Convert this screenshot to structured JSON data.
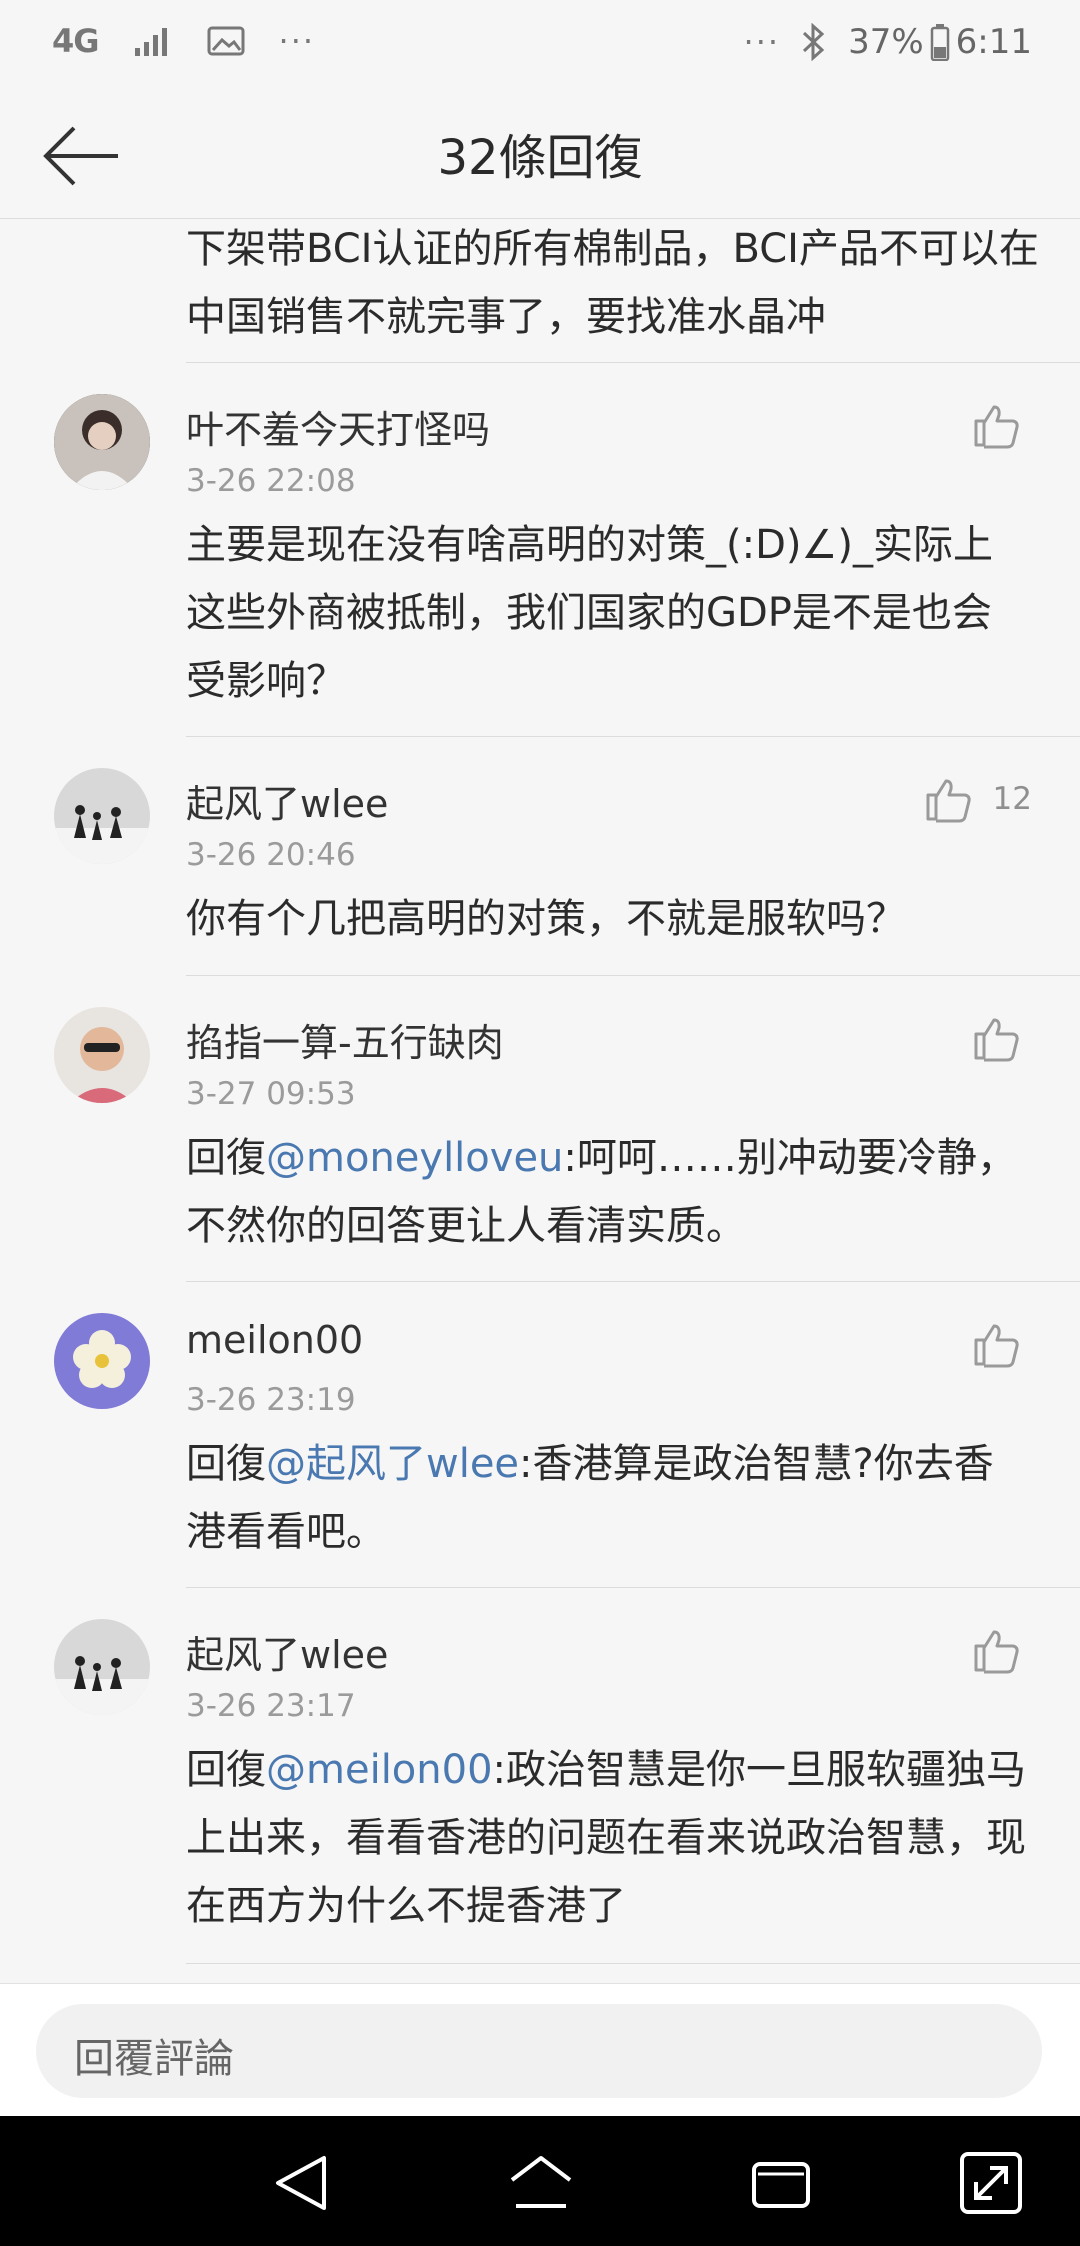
{
  "status_bar": {
    "network": "4G",
    "left_dots": "···",
    "right_dots": "···",
    "battery": "37%",
    "time": "6:11"
  },
  "header": {
    "title": "32條回復"
  },
  "partial_comment": {
    "text": "下架带BCI认证的所有棉制品，BCI产品不可以在中国销售不就完事了，要找准水晶冲"
  },
  "comments": [
    {
      "user": "叶不羞今天打怪吗",
      "time": "3-26 22:08",
      "text": "主要是现在没有啥高明的对策_(:D)∠)_实际上这些外商被抵制，我们国家的GDP是不是也会受影响？",
      "likes": ""
    },
    {
      "user": "起风了wlee",
      "time": "3-26 20:46",
      "text": "你有个几把高明的对策，不就是服软吗？",
      "likes": "12"
    },
    {
      "user": "掐指一算-五行缺肉",
      "time": "3-27 09:53",
      "prefix": "回復",
      "mention": "@moneylloveu",
      "text": ":呵呵……别冲动要冷静，不然你的回答更让人看清实质。",
      "likes": ""
    },
    {
      "user": "meilon00",
      "time": "3-26 23:19",
      "prefix": "回復",
      "mention": "@起风了wlee",
      "text": ":香港算是政治智慧?你去香港看看吧。",
      "likes": ""
    },
    {
      "user": "起风了wlee",
      "time": "3-26 23:17",
      "prefix": "回復",
      "mention": "@meilon00",
      "text": ":政治智慧是你一旦服软疆独马上出来，看看香港的问题在看来说政治智慧，现在西方为什么不提香港了",
      "likes": ""
    }
  ],
  "reply_bar": {
    "placeholder": "回覆評論"
  },
  "nav": {
    "icons": [
      "back-triangle-icon",
      "home-icon",
      "recents-icon",
      "expand-icon"
    ]
  },
  "colors": {
    "mention": "#4a78b0",
    "background": "#f6f6f6"
  }
}
